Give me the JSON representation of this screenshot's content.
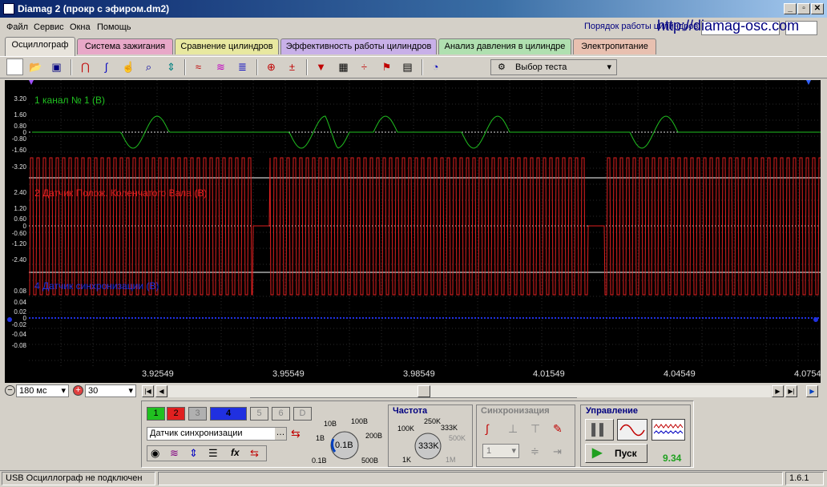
{
  "window": {
    "title": "Diamag 2 (прокр с эфиром.dm2)",
    "min": "_",
    "max": "▫",
    "close": "✕"
  },
  "menu": [
    "Файл",
    "Сервис",
    "Окна",
    "Помощь"
  ],
  "header": {
    "cylinder_label": "Порядок работы цилиндров",
    "site": "http://diamag-osc.com"
  },
  "tabs": [
    {
      "label": "Осциллограф",
      "color": "#e8e4dc"
    },
    {
      "label": "Система зажигания",
      "color": "#e8a8c8"
    },
    {
      "label": "Сравнение цилиндров",
      "color": "#e8e8a0"
    },
    {
      "label": "Эффективность работы цилиндров",
      "color": "#c8b0e8"
    },
    {
      "label": "Анализ давления в цилиндре",
      "color": "#b0e0b0"
    },
    {
      "label": "Электропитание",
      "color": "#e8c0b0"
    }
  ],
  "toolbar": {
    "test_select": "Выбор теста"
  },
  "channels": [
    {
      "label": "1 канал № 1 (В)",
      "color": "#20c020",
      "ticks": [
        "3.20",
        "1.60",
        "0.80",
        "0",
        "-0.80",
        "-1.60",
        "-3.20"
      ]
    },
    {
      "label": "2 Датчик Полож. Коленчатого Вала (В)",
      "color": "#e02020",
      "ticks": [
        "2.40",
        "1.20",
        "0.60",
        "0",
        "-0.60",
        "-1.20",
        "-2.40"
      ]
    },
    {
      "label": "4 Датчик синхронизации (В)",
      "color": "#2030e0",
      "ticks": [
        "0.08",
        "0.04",
        "0.02",
        "0",
        "-0.02",
        "-0.04",
        "-0.08"
      ]
    }
  ],
  "xaxis": {
    "ticks": [
      "3.92549",
      "3.95549",
      "3.98549",
      "4.01549",
      "4.04549",
      "4.0754"
    ]
  },
  "timebase": {
    "value": "180 мс",
    "count": "30"
  },
  "channel_buttons": [
    "1",
    "2",
    "3",
    "4",
    "5",
    "6",
    "D"
  ],
  "signal_select": "Датчик синхронизации",
  "voltage_knob": {
    "value": "0.1В",
    "labels": [
      "10В",
      "100В",
      "200В",
      "500В",
      "0.1В",
      "1В"
    ]
  },
  "frequency": {
    "title": "Частота",
    "value": "333K",
    "labels": [
      "250K",
      "333K",
      "500K",
      "100K",
      "1K",
      "1M"
    ]
  },
  "sync": {
    "title": "Синхронизация",
    "channel": "1"
  },
  "control": {
    "title": "Управление",
    "start": "Пуск",
    "value": "9.34"
  },
  "status": {
    "text": "USB Осциллограф не подключен",
    "version": "1.6.1"
  }
}
